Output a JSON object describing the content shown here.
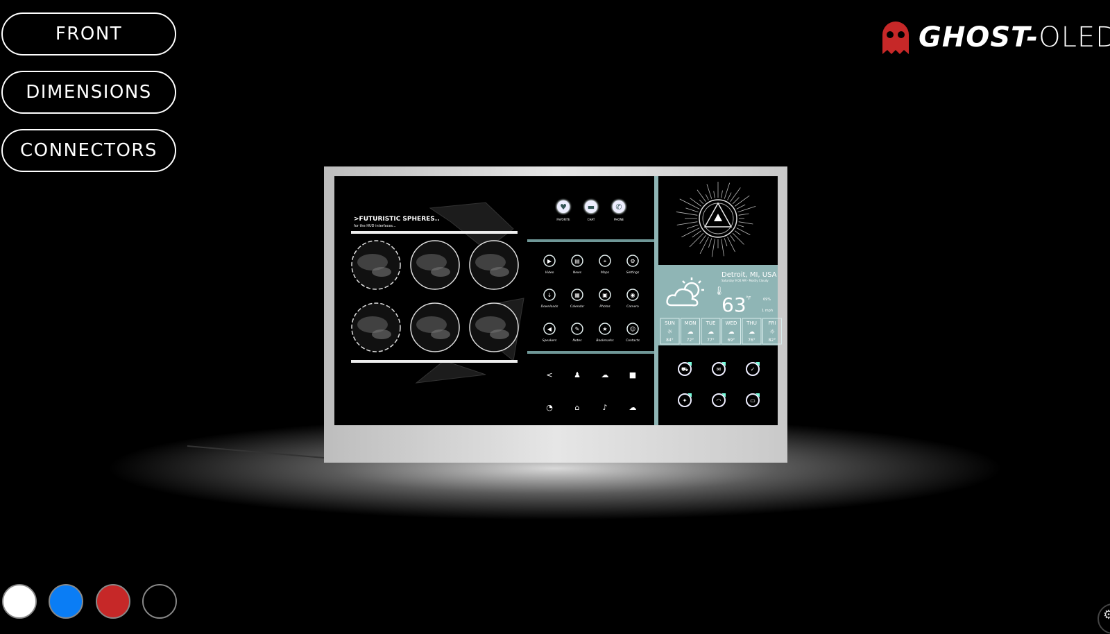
{
  "nav": {
    "buttons": [
      {
        "label": "FRONT"
      },
      {
        "label": "DIMENSIONS"
      },
      {
        "label": "CONNECTORS"
      }
    ]
  },
  "brand": {
    "logo_text_bold": "GHOST-",
    "logo_text_light": "OLED",
    "ghost_color": "#c62828"
  },
  "color_swatches": [
    {
      "name": "white",
      "color": "#ffffff"
    },
    {
      "name": "blue",
      "color": "#0a7df5"
    },
    {
      "name": "red",
      "color": "#c62828"
    },
    {
      "name": "black",
      "color": "#000000"
    }
  ],
  "screen": {
    "hud": {
      "title": ">FUTURISTIC SPHERES..",
      "subtitle": "for the HUD interfaces..."
    },
    "top_icons": [
      {
        "icon": "heart-icon",
        "label": "FAVORITE"
      },
      {
        "icon": "chat-icon",
        "label": "CHAT"
      },
      {
        "icon": "phone-icon",
        "label": "PHONE"
      }
    ],
    "grid_icons": [
      {
        "icon": "video-icon",
        "label": "Video"
      },
      {
        "icon": "news-icon",
        "label": "News"
      },
      {
        "icon": "map-pin-icon",
        "label": "Maps"
      },
      {
        "icon": "settings-icon",
        "label": "Settings"
      },
      {
        "icon": "download-icon",
        "label": "Downloads"
      },
      {
        "icon": "calendar-icon",
        "label": "Calendar"
      },
      {
        "icon": "photo-icon",
        "label": "Photos"
      },
      {
        "icon": "camera-icon",
        "label": "Camera"
      },
      {
        "icon": "speaker-icon",
        "label": "Speakers"
      },
      {
        "icon": "pencil-icon",
        "label": "Notes"
      },
      {
        "icon": "star-icon",
        "label": "Bookmarks"
      },
      {
        "icon": "contact-icon",
        "label": "Contacts"
      }
    ],
    "bottom_icons": [
      "share-icon",
      "people-icon",
      "cloud-download-icon",
      "lock-icon",
      "clock-icon",
      "home-icon",
      "music-icon",
      "cloud-upload-icon"
    ],
    "weather": {
      "location": "Detroit, MI, USA",
      "details": "Saturday 9:00 AM · Mostly Cloudy",
      "temperature": "63",
      "unit": "°F",
      "humidity": "69%",
      "wind": "1 mph",
      "forecast": [
        {
          "day": "SUN",
          "temp": "84°"
        },
        {
          "day": "MON",
          "temp": "72°"
        },
        {
          "day": "TUE",
          "temp": "77°"
        },
        {
          "day": "WED",
          "temp": "69°"
        },
        {
          "day": "THU",
          "temp": "76°"
        },
        {
          "day": "FRI",
          "temp": "82°"
        }
      ]
    },
    "social_icons": [
      "cart-icon",
      "mail-icon",
      "thumbs-up-icon",
      "twitter-icon",
      "rss-icon",
      "message-icon"
    ],
    "accent": "#8fb5b5"
  }
}
